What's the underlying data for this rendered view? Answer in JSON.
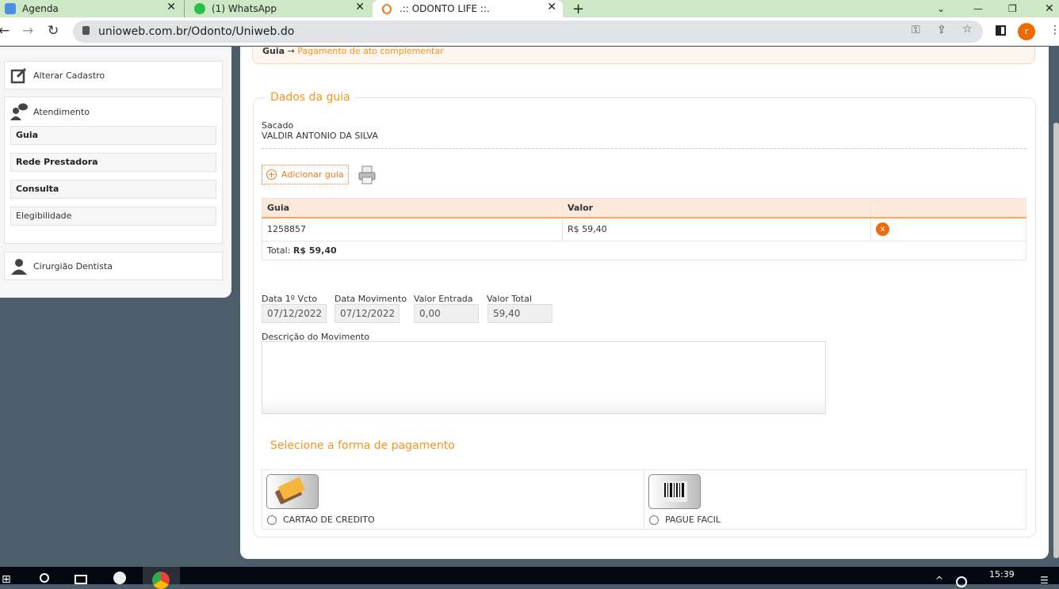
{
  "browser": {
    "tabs": [
      {
        "label": "Agenda"
      },
      {
        "label": "(1) WhatsApp"
      },
      {
        "label": ".:: ODONTO LIFE ::."
      }
    ],
    "url": "unioweb.com.br/Odonto/Uniweb.do",
    "profile_initial": "r"
  },
  "sidebar": {
    "alterar": "Alterar Cadastro",
    "atendimento": "Atendimento",
    "items": [
      {
        "label": "Guia"
      },
      {
        "label": "Rede Prestadora"
      },
      {
        "label": "Consulta"
      },
      {
        "label": "Elegibilidade"
      }
    ],
    "cirurgiao": "Cirurgião Dentista"
  },
  "breadcrumb": {
    "root": "Guia",
    "arrow": "→",
    "current": "Pagamento de ato complementar"
  },
  "guia": {
    "legend": "Dados da guia",
    "sacado_label": "Sacado",
    "sacado_value": "VALDIR ANTONIO DA SILVA",
    "add_label": "Adicionar guia",
    "table": {
      "headers": [
        "Guia",
        "Valor",
        ""
      ],
      "rows": [
        {
          "guia": "1258857",
          "valor": "R$ 59,40",
          "remove": "x"
        }
      ],
      "total_label": "Total:",
      "total_value": "R$ 59,40"
    },
    "fields": [
      {
        "label": "Data 1º Vcto",
        "value": "07/12/2022"
      },
      {
        "label": "Data Movimento",
        "value": "07/12/2022"
      },
      {
        "label": "Valor Entrada",
        "value": "0,00"
      },
      {
        "label": "Valor Total",
        "value": "59,40"
      }
    ],
    "descricao_label": "Descrição do Movimento",
    "descricao_value": ""
  },
  "pagamento": {
    "legend": "Selecione a forma de pagamento",
    "options": [
      {
        "label": "CARTAO DE CREDITO",
        "selected": false
      },
      {
        "label": "PAGUE FACIL",
        "selected": false
      }
    ]
  },
  "taskbar": {
    "time": "15:39"
  },
  "colors": {
    "accent": "#f7941d",
    "remove": "#f26a10",
    "background": "#4c5e6c"
  }
}
